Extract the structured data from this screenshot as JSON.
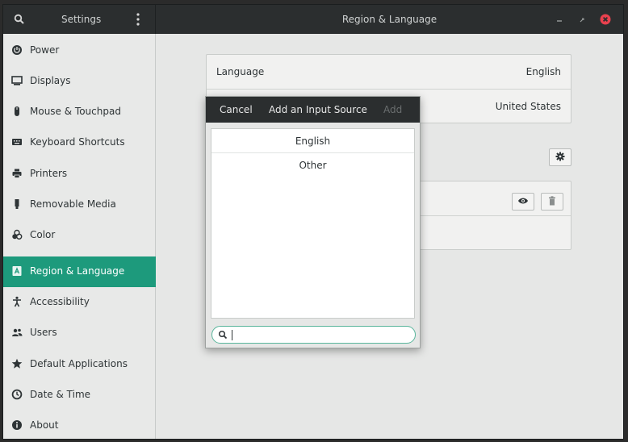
{
  "titlebar": {
    "left_title": "Settings",
    "title": "Region & Language",
    "icons": [
      "search-icon",
      "menu-dots-icon",
      "minimize-icon",
      "maximize-icon",
      "close-icon"
    ]
  },
  "sidebar": {
    "items": [
      {
        "label": "Power",
        "icon": "power-icon"
      },
      {
        "label": "Displays",
        "icon": "display-icon"
      },
      {
        "label": "Mouse & Touchpad",
        "icon": "mouse-icon"
      },
      {
        "label": "Keyboard Shortcuts",
        "icon": "keyboard-icon"
      },
      {
        "label": "Printers",
        "icon": "printer-icon"
      },
      {
        "label": "Removable Media",
        "icon": "removable-media-icon"
      },
      {
        "label": "Color",
        "icon": "color-icon"
      },
      {
        "label": "Region & Language",
        "icon": "region-icon",
        "active": true
      },
      {
        "label": "Accessibility",
        "icon": "accessibility-icon"
      },
      {
        "label": "Users",
        "icon": "users-icon"
      },
      {
        "label": "Default Applications",
        "icon": "star-icon"
      },
      {
        "label": "Date & Time",
        "icon": "clock-icon"
      },
      {
        "label": "About",
        "icon": "info-icon"
      }
    ]
  },
  "main": {
    "language": {
      "label": "Language",
      "value": "English"
    },
    "formats": {
      "value": "United States"
    }
  },
  "dialog": {
    "cancel_label": "Cancel",
    "title": "Add an Input Source",
    "add_label": "Add",
    "items": [
      "English",
      "Other"
    ],
    "search_value": ""
  },
  "colors": {
    "accent": "#1d9a7c",
    "titlebar": "#2b2e2f",
    "close": "#e9414e",
    "search_border": "#58b59b"
  }
}
